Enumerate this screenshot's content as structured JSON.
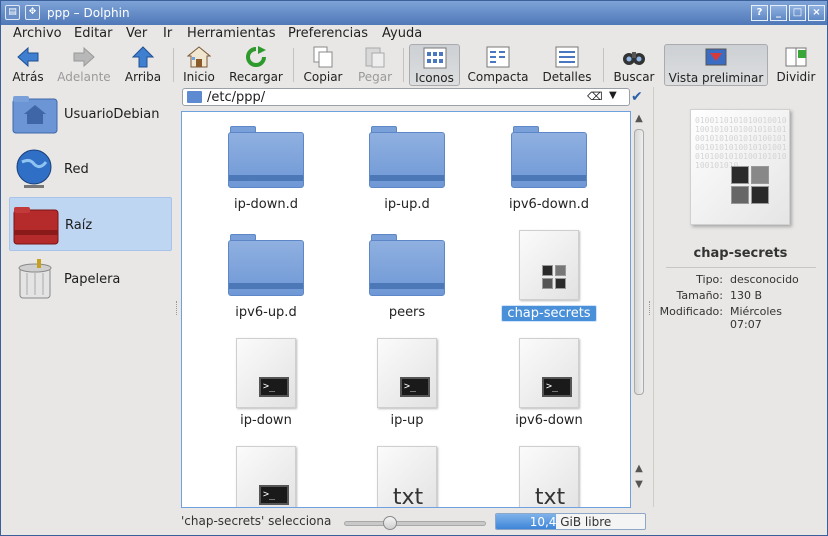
{
  "window": {
    "title": "ppp – Dolphin",
    "controls": [
      "?",
      "_",
      "□",
      "×"
    ]
  },
  "menu": [
    {
      "label": "Archivo"
    },
    {
      "label": "Editar"
    },
    {
      "label": "Ver"
    },
    {
      "label": "Ir"
    },
    {
      "label": "Herramientas"
    },
    {
      "label": "Preferencias"
    },
    {
      "label": "Ayuda"
    }
  ],
  "toolbar": {
    "back": "Atrás",
    "forward": "Adelante",
    "up": "Arriba",
    "home": "Inicio",
    "reload": "Recargar",
    "copy": "Copiar",
    "paste": "Pegar",
    "icons": "Iconos",
    "compact": "Compacta",
    "details": "Detalles",
    "search": "Buscar",
    "preview": "Vista preliminar",
    "split": "Dividir"
  },
  "places": [
    {
      "label": "UsuarioDebian",
      "icon": "user-home-folder-icon"
    },
    {
      "label": "Red",
      "icon": "network-globe-icon"
    },
    {
      "label": "Raíz",
      "icon": "root-folder-icon",
      "active": true
    },
    {
      "label": "Papelera",
      "icon": "trash-icon"
    }
  ],
  "location": {
    "path": "/etc/ppp/"
  },
  "files": [
    {
      "name": "ip-down.d",
      "type": "folder"
    },
    {
      "name": "ip-up.d",
      "type": "folder"
    },
    {
      "name": "ipv6-down.d",
      "type": "folder"
    },
    {
      "name": "ipv6-up.d",
      "type": "folder"
    },
    {
      "name": "peers",
      "type": "folder"
    },
    {
      "name": "chap-secrets",
      "type": "unknown",
      "selected": true
    },
    {
      "name": "ip-down",
      "type": "script"
    },
    {
      "name": "ip-up",
      "type": "script"
    },
    {
      "name": "ipv6-down",
      "type": "script"
    },
    {
      "name": "",
      "type": "script"
    },
    {
      "name": "",
      "type": "text"
    },
    {
      "name": "",
      "type": "text"
    }
  ],
  "info": {
    "filename": "chap-secrets",
    "tipo_label": "Tipo:",
    "tipo_value": "desconocido",
    "tamano_label": "Tamaño:",
    "tamano_value": "130 B",
    "modificado_label": "Modificado:",
    "modificado_value_1": "Miércoles",
    "modificado_value_2": "07:07",
    "preview_bits": "01001101010100100101001010101001010101001010100101010010100101010100101010010101001010100101010100101010"
  },
  "status": {
    "message": "'chap-secrets' seleccionado",
    "zoom_level": 0.3,
    "free_space_value": "10,4",
    "free_space_suffix": " GiB libre",
    "used_fraction": 0.4
  },
  "text_glyphs": {
    "prompt": ">_",
    "txt": "txt"
  }
}
